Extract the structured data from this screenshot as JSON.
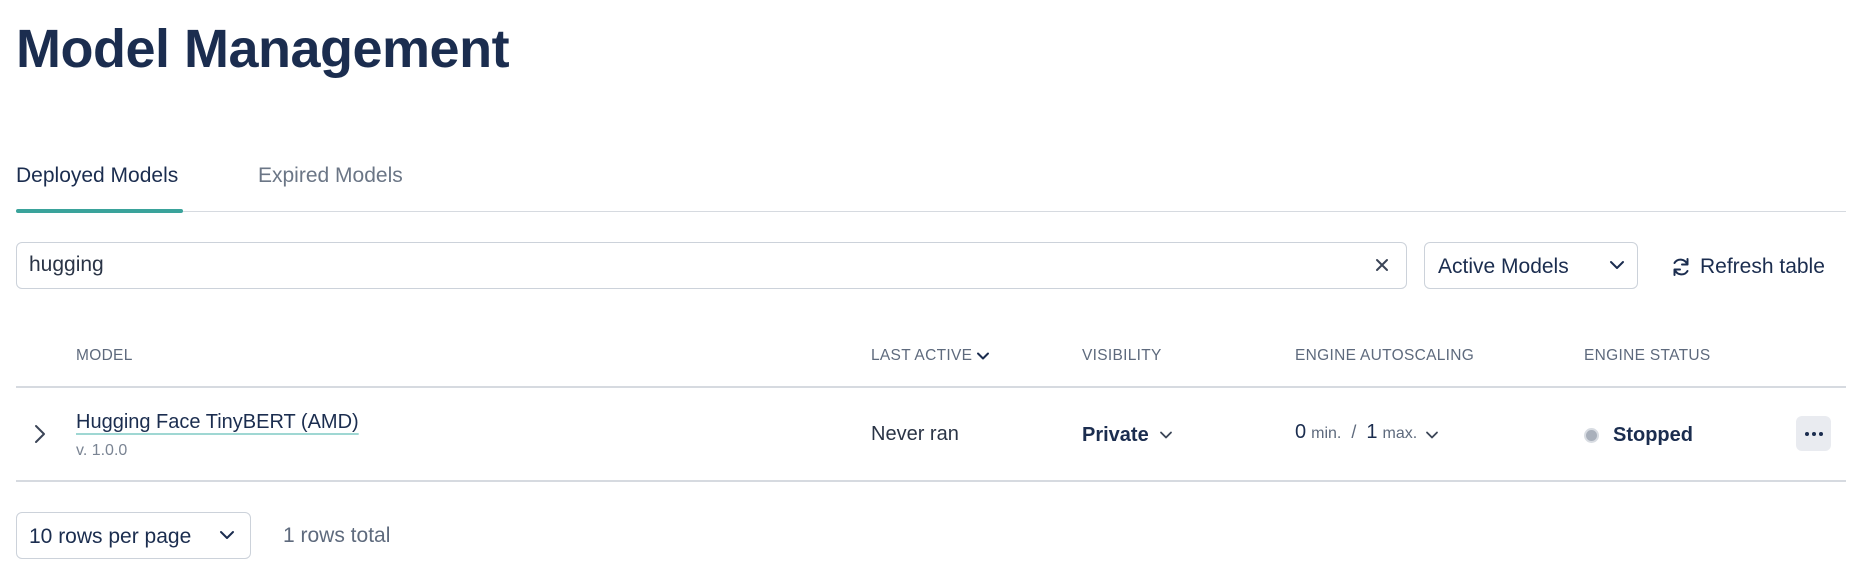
{
  "page": {
    "title": "Model Management"
  },
  "tabs": [
    {
      "label": "Deployed Models",
      "active": true
    },
    {
      "label": "Expired Models",
      "active": false
    }
  ],
  "search": {
    "value": "hugging",
    "placeholder": ""
  },
  "filter": {
    "selected": "Active Models"
  },
  "refresh": {
    "label": "Refresh table"
  },
  "table": {
    "columns": {
      "model": "MODEL",
      "last_active": "LAST ACTIVE",
      "visibility": "VISIBILITY",
      "engine_autoscaling": "ENGINE AUTOSCALING",
      "engine_status": "ENGINE STATUS"
    },
    "rows": [
      {
        "name": "Hugging Face TinyBERT (AMD)",
        "version": "v. 1.0.0",
        "last_active": "Never ran",
        "visibility": "Private",
        "min": "0",
        "min_unit": "min.",
        "separator": "/",
        "max": "1",
        "max_unit": "max.",
        "status": "Stopped"
      }
    ]
  },
  "pagination": {
    "rows_per_page": "10 rows per page",
    "total": "1 rows total"
  },
  "icons": {
    "clear": "close-icon",
    "dropdown": "chevron-down-icon",
    "refresh": "refresh-icon",
    "expand": "chevron-right-icon",
    "sort": "sort-desc-icon",
    "more": "ellipsis-icon"
  },
  "colors": {
    "accent": "#3aa39b",
    "title": "#1b2d4f",
    "status_stopped": "#a9b0bb"
  }
}
